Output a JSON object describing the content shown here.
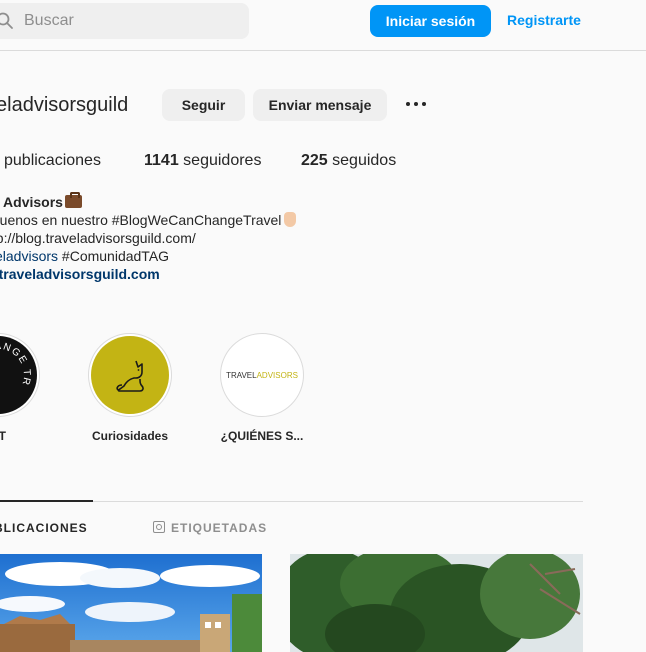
{
  "search": {
    "placeholder": "Buscar"
  },
  "auth": {
    "login_label": "Iniciar sesión",
    "register_label": "Registrarte"
  },
  "profile": {
    "username": "veladvisorsguild",
    "follow_label": "Seguir",
    "message_label": "Enviar mensaje",
    "stats": {
      "posts_label": "publicaciones",
      "followers_count": "1141",
      "followers_label": "seguidores",
      "following_count": "225",
      "following_label": "seguidos"
    },
    "bio": {
      "name": "el Advisors",
      "line1": "íguenos en nuestro #BlogWeCanChangeTravel",
      "line2": "ttp://blog.traveladvisorsguild.com/",
      "line3_tag": "veladvisors",
      "line3_rest": " #ComunidadTAG",
      "link": "v.traveladvisorsguild.com"
    }
  },
  "highlights": [
    {
      "label": "CT",
      "ring_text": "CHANGE TR"
    },
    {
      "label": "Curiosidades",
      "color": "#c3b414"
    },
    {
      "label": "¿QUIÉNES S...",
      "logo_travel": "TRAVEL",
      "logo_advisors": "ADVISORS"
    }
  ],
  "tabs": {
    "active": "BLICACIONES",
    "inactive": "ETIQUETADAS"
  },
  "colors": {
    "accent": "#0095f6",
    "link": "#00376b",
    "highlight_yellow": "#c3b414"
  }
}
